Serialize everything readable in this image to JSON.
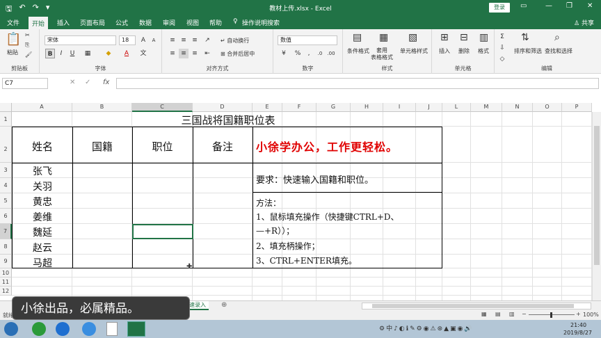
{
  "title_bar": {
    "title": "教材上传.xlsx - Excel",
    "login": "登录"
  },
  "tabs": [
    "文件",
    "开始",
    "插入",
    "页面布局",
    "公式",
    "数据",
    "审阅",
    "视图",
    "帮助"
  ],
  "tell_me": "操作说明搜索",
  "share": "共享",
  "ribbon": {
    "paste": "粘贴",
    "clipboard": "剪贴板",
    "font_name": "宋体",
    "font_size": "18",
    "bold": "B",
    "italic": "I",
    "underline": "U",
    "font_group": "字体",
    "wrap": "自动换行",
    "merge": "合并后居中",
    "alignment_group": "对齐方式",
    "number_format": "数值",
    "number_group": "数字",
    "cond_format": "条件格式",
    "table_format": "套用\n表格格式",
    "cell_style": "单元格样式",
    "styles_group": "样式",
    "insert": "插入",
    "delete": "删除",
    "format": "格式",
    "cells_group": "单元格",
    "sort_filter": "排序和筛选",
    "find_select": "查找和选择",
    "editing_group": "编辑"
  },
  "formula_bar": {
    "name_box": "C7",
    "fx": "fx"
  },
  "columns": [
    "A",
    "B",
    "C",
    "D",
    "E",
    "F",
    "G",
    "H",
    "I",
    "J",
    "L",
    "M",
    "N",
    "O",
    "P"
  ],
  "rows": [
    "1",
    "2",
    "3",
    "4",
    "5",
    "6",
    "7",
    "8",
    "9",
    "10",
    "11",
    "12"
  ],
  "sheet": {
    "title": "三国战将国籍职位表",
    "headers": [
      "姓名",
      "国籍",
      "职位",
      "备注"
    ],
    "names": [
      "张飞",
      "关羽",
      "黄忠",
      "姜维",
      "魏延",
      "赵云",
      "马超"
    ],
    "slogan": "小徐学办公，工作更轻松。",
    "requirement": "要求：快速输入国籍和职位。",
    "method_lines": [
      "方法：",
      "1、鼠标填充操作（快捷键CTRL+D、",
      "—+R））；",
      "2、填充柄操作；",
      "3、CTRL+ENTER填充。"
    ]
  },
  "sheet_tab": "数据的快速录入",
  "status": {
    "left": "就绪",
    "zoom": "100%"
  },
  "overlay": "小徐出品，必属精品。",
  "taskbar": {
    "time": "21:40",
    "date": "2019/8/27"
  }
}
